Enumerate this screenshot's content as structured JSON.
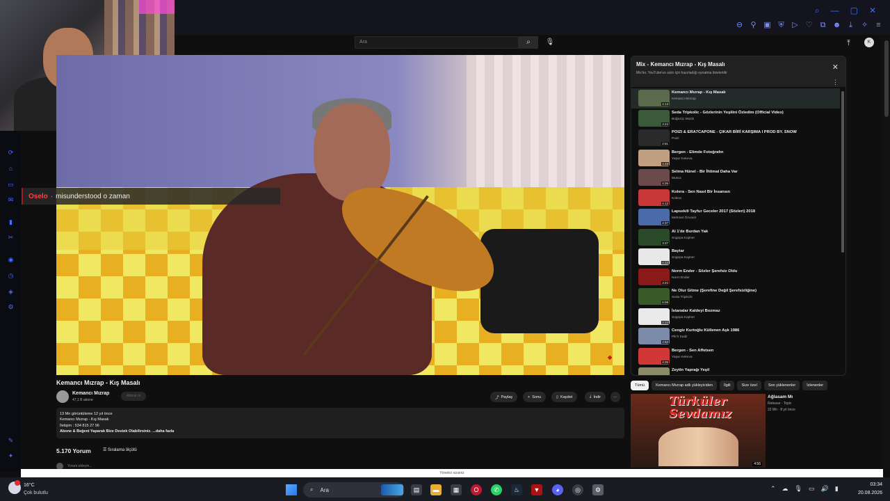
{
  "header": {
    "search_placeholder": "Ara",
    "search_icon": "search-icon",
    "mic_icon": "mic-icon"
  },
  "chat_overlay": {
    "username": "Oselo",
    "separator": "·",
    "message": "misunderstood o zaman"
  },
  "video": {
    "title": "Kemancı Mızrap - Kış Masalı",
    "channel": "Kemancı Mızrap",
    "subscribers": "47,1 B abone",
    "subscribe_label": "Abone ol",
    "actions": {
      "share": "Paylaş",
      "clip": "Sonu",
      "save": "Kaydet",
      "download": "İndir",
      "more": "···"
    },
    "description_lines": [
      "13 Mn görüntüleme  12 yıl önce",
      "Kemancı Mızrap - Kış Masalı",
      "İletişim : 534 815 27 96",
      "Abone & Beğeni Yaparak Bize  Destek Olabilirsiniz.  ...daha fazla"
    ],
    "comment_count": "5.170 Yorum",
    "sort_label": "Sıralama ölçütü",
    "add_comment": "Yorum ekleyin..."
  },
  "playlist": {
    "title": "Mix - Kemancı Mızrap - Kış Masalı",
    "subtitle": "Mix'ler, YouTube'un sizin için hazırladığı oynatma listeleridir",
    "items": [
      {
        "title": "Kemancı Mızrap - Kış Masalı",
        "channel": "Kemancı Mızrap",
        "duration": "4:13"
      },
      {
        "title": "Seda Tripkolic - Gözlerinin Yeşilini Özledim (Official Video)",
        "channel": "Boğaziçi Müzik",
        "duration": "3:24"
      },
      {
        "title": "POIZI & ERA7CAPONE - ÇIKAR BİRİ KARŞIMA I PROD BY. SNOW",
        "channel": "Poizi",
        "duration": "2:51"
      },
      {
        "title": "Bergen - Elimde Fotoğrafın",
        "channel": "Yaşar Kekeva",
        "duration": "4:48"
      },
      {
        "title": "Selma Hünel - Bir İhtimal Daha Var",
        "channel": "Musuc",
        "duration": "4:26"
      },
      {
        "title": "Kolera - Sen Nasıl Bir İnsansın",
        "channel": "Kolera",
        "duration": "4:12"
      },
      {
        "title": "Lapsekili Tayfur Geceler 2017 (Sözleri) 2018",
        "channel": "Mehmet Özvanir",
        "duration": "4:37"
      },
      {
        "title": "Al 1'de Burdan Yak",
        "channel": "Sogopa Kajmer",
        "duration": "3:37"
      },
      {
        "title": "Baytar",
        "channel": "Sogopa Kajmer",
        "duration": "4:33"
      },
      {
        "title": "Norm Ender - Sözler Şerefsiz Oldu",
        "channel": "Norm Ender",
        "duration": "3:24"
      },
      {
        "title": "Ne Olur Gitme (Şerefine Değil Şerefsizliğine)",
        "channel": "Seda Tripkolic",
        "duration": "6:09"
      },
      {
        "title": "İstanalar Kaldeyi Bozmaz",
        "channel": "Sogopa Kajmer",
        "duration": "2:22"
      },
      {
        "title": "Cengiz Kurtoğlu Küllenen Aşk 1986",
        "channel": "Plk'lr Kadir",
        "duration": "4:50"
      },
      {
        "title": "Bergen - Sen Affetsen",
        "channel": "Yaşar Kekeva",
        "duration": "4:25"
      },
      {
        "title": "Zeytin Yaprağı Yeşil",
        "channel": "",
        "duration": ""
      }
    ]
  },
  "chips": [
    "Tümü",
    "Kemancı Mızrap adlı yükleyiciden",
    "İlgili",
    "Size özel",
    "Son yüklenenler",
    "İzlenenler"
  ],
  "recommendation": {
    "thumb_title": "Türküler Sevdamız",
    "duration": "4:56",
    "title": "Ağlasam Mı",
    "artist": "Release - Topic",
    "meta": "22 Mn · 8 yıl önce"
  },
  "notice": "Yönetici sizsiniz",
  "taskbar": {
    "temperature": "16°C",
    "condition": "Çok bulutlu",
    "search_label": "Ara",
    "time": "03:34",
    "date": "20.08.2026"
  },
  "colors": {
    "accent": "#3d6bff",
    "chat_user": "#ff4040",
    "title_red": "#e02424"
  }
}
